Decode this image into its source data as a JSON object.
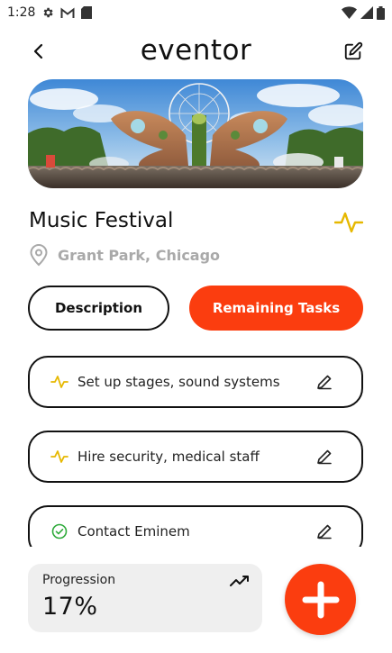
{
  "status_bar": {
    "time": "1:28",
    "left_icons": [
      "gear-icon",
      "gmail-icon",
      "sd-card-icon"
    ],
    "right_icons": [
      "wifi-icon",
      "signal-icon",
      "battery-icon"
    ]
  },
  "header": {
    "title": "eventor",
    "back_icon": "chevron-left-icon",
    "edit_icon": "edit-square-icon"
  },
  "event": {
    "image": "festival-stage-photo",
    "title": "Music Festival",
    "location": "Grant Park, Chicago",
    "activity_icon": "activity-pulse-icon"
  },
  "tabs": [
    {
      "label": "Description",
      "active": false
    },
    {
      "label": "Remaining Tasks",
      "active": true
    }
  ],
  "tasks": [
    {
      "label": "Set up stages, sound systems",
      "status_icon": "activity-pulse-icon",
      "edit_icon": "pencil-icon"
    },
    {
      "label": "Hire security, medical staff",
      "status_icon": "activity-pulse-icon",
      "edit_icon": "pencil-icon"
    },
    {
      "label": "Contact Eminem",
      "status_icon": "check-circle-icon",
      "edit_icon": "pencil-icon"
    }
  ],
  "progression": {
    "label": "Progression",
    "value": "17%",
    "icon": "trending-up-icon"
  },
  "fab": {
    "icon": "plus-icon"
  },
  "colors": {
    "accent": "#fb3d0f",
    "pending": "#e6b800",
    "done": "#2eaa3a",
    "muted": "#a9a9a9",
    "card_bg": "#efefef"
  }
}
